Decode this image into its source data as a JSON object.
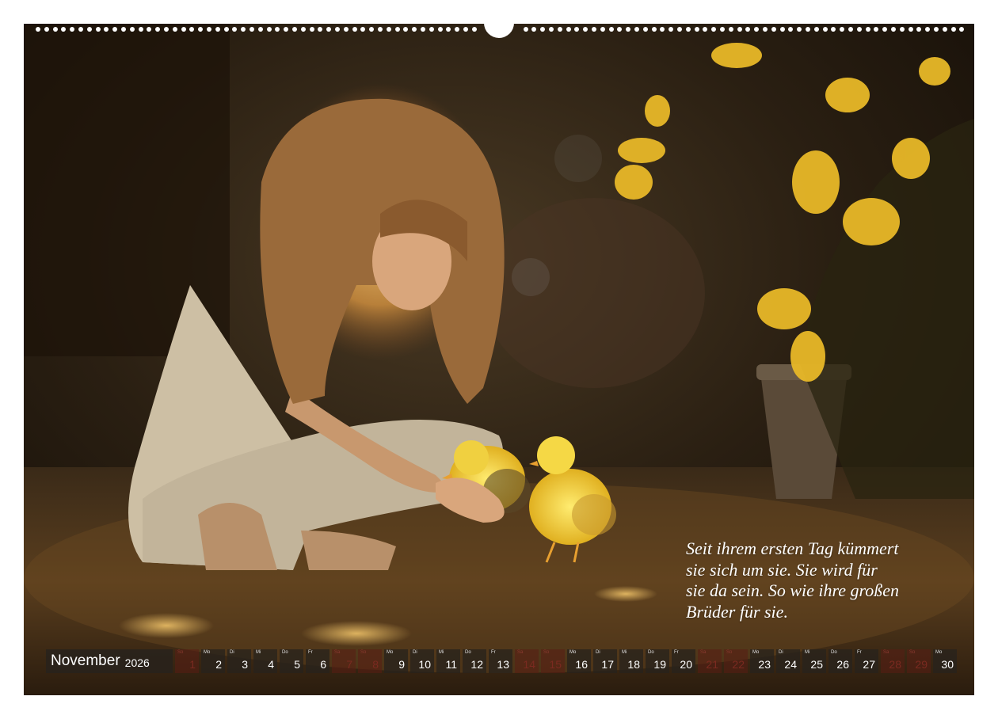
{
  "quote": {
    "line1": "Seit ihrem ersten Tag kümmert",
    "line2": "sie sich um sie. Sie wird für",
    "line3": "sie da sein. So wie ihre großen",
    "line4": "Brüder für sie."
  },
  "calendar": {
    "month": "November",
    "year": "2026",
    "days": [
      {
        "d": "1",
        "wd": "So",
        "weekend": true
      },
      {
        "d": "2",
        "wd": "Mo",
        "weekend": false
      },
      {
        "d": "3",
        "wd": "Di",
        "weekend": false
      },
      {
        "d": "4",
        "wd": "Mi",
        "weekend": false
      },
      {
        "d": "5",
        "wd": "Do",
        "weekend": false
      },
      {
        "d": "6",
        "wd": "Fr",
        "weekend": false
      },
      {
        "d": "7",
        "wd": "Sa",
        "weekend": true
      },
      {
        "d": "8",
        "wd": "So",
        "weekend": true
      },
      {
        "d": "9",
        "wd": "Mo",
        "weekend": false
      },
      {
        "d": "10",
        "wd": "Di",
        "weekend": false
      },
      {
        "d": "11",
        "wd": "Mi",
        "weekend": false
      },
      {
        "d": "12",
        "wd": "Do",
        "weekend": false
      },
      {
        "d": "13",
        "wd": "Fr",
        "weekend": false
      },
      {
        "d": "14",
        "wd": "Sa",
        "weekend": true
      },
      {
        "d": "15",
        "wd": "So",
        "weekend": true
      },
      {
        "d": "16",
        "wd": "Mo",
        "weekend": false
      },
      {
        "d": "17",
        "wd": "Di",
        "weekend": false
      },
      {
        "d": "18",
        "wd": "Mi",
        "weekend": false
      },
      {
        "d": "19",
        "wd": "Do",
        "weekend": false
      },
      {
        "d": "20",
        "wd": "Fr",
        "weekend": false
      },
      {
        "d": "21",
        "wd": "Sa",
        "weekend": true
      },
      {
        "d": "22",
        "wd": "So",
        "weekend": true
      },
      {
        "d": "23",
        "wd": "Mo",
        "weekend": false
      },
      {
        "d": "24",
        "wd": "Di",
        "weekend": false
      },
      {
        "d": "25",
        "wd": "Mi",
        "weekend": false
      },
      {
        "d": "26",
        "wd": "Do",
        "weekend": false
      },
      {
        "d": "27",
        "wd": "Fr",
        "weekend": false
      },
      {
        "d": "28",
        "wd": "Sa",
        "weekend": true
      },
      {
        "d": "29",
        "wd": "So",
        "weekend": true
      },
      {
        "d": "30",
        "wd": "Mo",
        "weekend": false
      }
    ]
  },
  "colors": {
    "cell_bg": "#28221c",
    "weekend_text": "#7a2a20",
    "text": "#ffffff"
  }
}
